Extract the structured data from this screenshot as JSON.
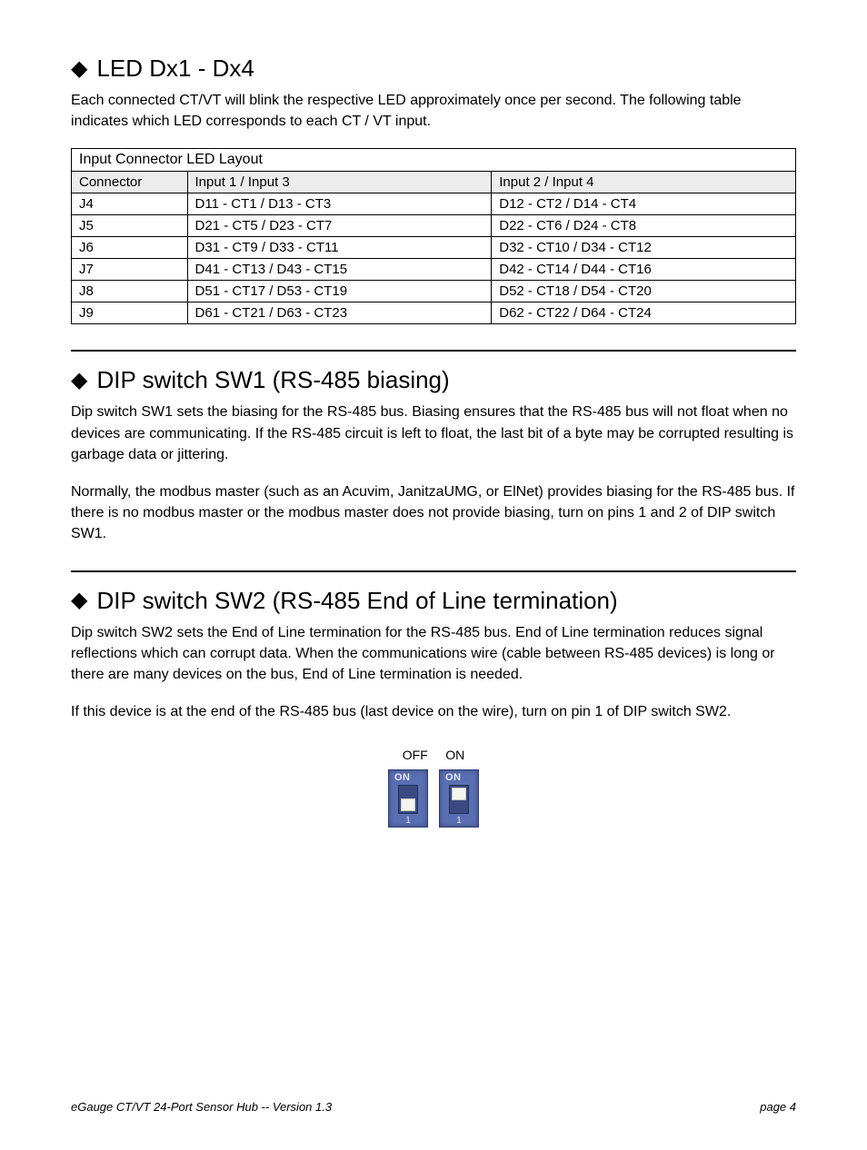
{
  "sections": {
    "led": {
      "heading": "LED Dx1 - Dx4",
      "intro": "Each connected CT/VT will blink the respective LED approximately once per second. The following table indicates which LED corresponds to each CT / VT input."
    },
    "sw1": {
      "heading": "DIP switch SW1 (RS-485 biasing)",
      "p1": "Dip switch SW1 sets the biasing for the RS-485 bus. Biasing ensures that the RS-485 bus will not float when no devices are communicating. If the RS-485 circuit is left to float, the last bit of a byte may be corrupted resulting is garbage data or jittering.",
      "p2": "Normally, the modbus master (such as an Acuvim, JanitzaUMG, or ElNet) provides biasing for the RS-485 bus. If there is no modbus master or the modbus master does not provide biasing, turn on pins 1 and 2 of DIP switch SW1."
    },
    "sw2": {
      "heading": "DIP switch SW2 (RS-485 End of Line termination)",
      "p1": "Dip switch SW2 sets the End of Line termination for the RS-485 bus. End of Line termination reduces signal reflections which can corrupt data. When the communications wire (cable between RS-485 devices) is long or there are many devices on the bus, End of Line termination is needed.",
      "p2": "If this device is at the end of the RS-485 bus (last device on the wire), turn on pin 1 of DIP switch SW2.",
      "switch_label": "OFF     ON"
    }
  },
  "table": {
    "title": "Input Connector LED Layout",
    "headers": [
      "Connector",
      "Input 1  /  Input 3",
      "Input 2  /  Input 4"
    ],
    "rows": [
      [
        "J4",
        "D11 - CT1 / D13 - CT3",
        "D12 - CT2 / D14 - CT4"
      ],
      [
        "J5",
        "D21 - CT5 / D23 - CT7",
        "D22 - CT6 / D24 - CT8"
      ],
      [
        "J6",
        "D31 - CT9 / D33 - CT11",
        "D32 - CT10 / D34 - CT12"
      ],
      [
        "J7",
        "D41 - CT13 / D43 - CT15",
        "D42 - CT14 / D44 - CT16"
      ],
      [
        "J8",
        "D51 - CT17 / D53 - CT19",
        "D52 - CT18 / D54 - CT20"
      ],
      [
        "J9",
        "D61 - CT21 / D63 - CT23",
        "D62 - CT22 / D64 - CT24"
      ]
    ]
  },
  "footer": {
    "left": "eGauge CT/VT 24-Port Sensor Hub -- Version 1.3",
    "right": "page 4"
  }
}
